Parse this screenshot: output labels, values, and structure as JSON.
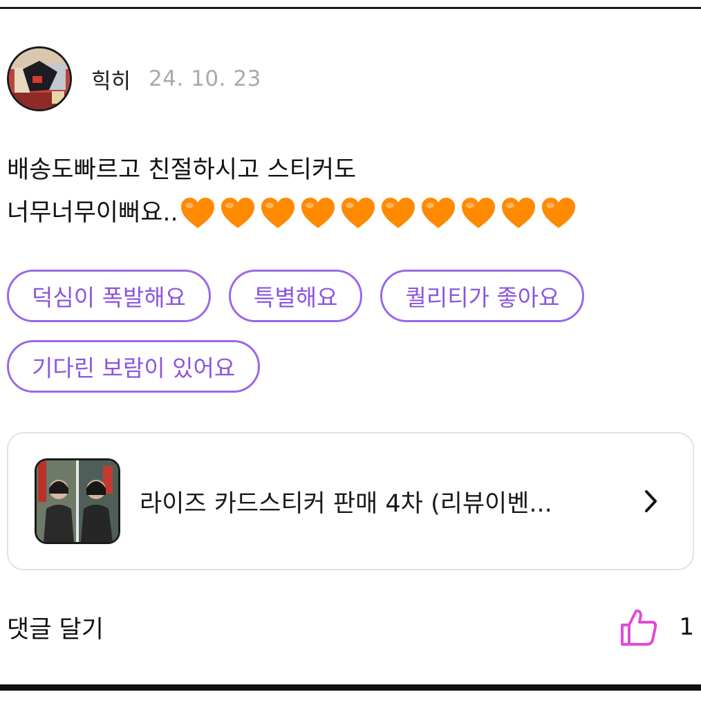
{
  "review": {
    "username": "힉히",
    "date": "24. 10. 23",
    "body_line1": "배송도빠르고 친절하시고 스티커도",
    "body_line2": "너무너무이뻐요..",
    "heart_count_icon": "orange-heart-emoji",
    "tags_row1": [
      "덕심이 폭발해요",
      "특별해요",
      "퀄리티가 좋아요"
    ],
    "tags_row2": [
      "기다린 보람이 있어요"
    ]
  },
  "product": {
    "title": "라이즈 카드스티커 판매 4차 (리뷰이벤...",
    "chevron_icon": "chevron-right-icon"
  },
  "footer": {
    "comment_label": "댓글 달기",
    "like_icon": "thumbs-up-icon",
    "like_count": "1"
  },
  "colors": {
    "tag_accent": "#9a67ea",
    "like_accent": "#e14bd8",
    "heart": "#ff8a00"
  }
}
